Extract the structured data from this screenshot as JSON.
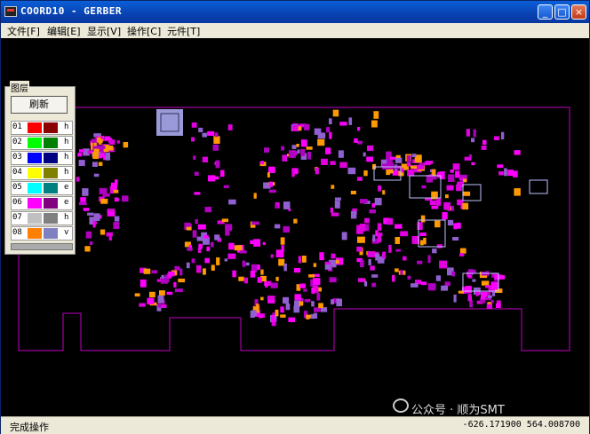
{
  "window": {
    "title": "COORD10 - GERBER",
    "controls": {
      "minimize": "_",
      "maximize": "□",
      "close": "×"
    }
  },
  "menu": [
    {
      "label": "文件[F]"
    },
    {
      "label": "编辑[E]"
    },
    {
      "label": "显示[V]"
    },
    {
      "label": "操作[C]"
    },
    {
      "label": "元件[T]"
    }
  ],
  "layer_panel": {
    "title": "图层",
    "refresh_label": "刷新",
    "layers": [
      {
        "num": "01",
        "color_a": "#ff0000",
        "color_b": "#8b0000",
        "flag": "h"
      },
      {
        "num": "02",
        "color_a": "#00ff00",
        "color_b": "#008000",
        "flag": "h"
      },
      {
        "num": "03",
        "color_a": "#0000ff",
        "color_b": "#000080",
        "flag": "h"
      },
      {
        "num": "04",
        "color_a": "#ffff00",
        "color_b": "#808000",
        "flag": "h"
      },
      {
        "num": "05",
        "color_a": "#00ffff",
        "color_b": "#008080",
        "flag": "e"
      },
      {
        "num": "06",
        "color_a": "#ff00ff",
        "color_b": "#800080",
        "flag": "e"
      },
      {
        "num": "07",
        "color_a": "#c0c0c0",
        "color_b": "#808080",
        "flag": "h"
      },
      {
        "num": "08",
        "color_a": "#ff8000",
        "color_b": "#8080c0",
        "flag": "v"
      }
    ]
  },
  "status": {
    "message": "完成操作",
    "coordinates": "-626.171900 564.008700"
  },
  "watermark": "公众号 · 顺为SMT",
  "colors": {
    "board_outline": "#c000c0",
    "pads": "#e000e0",
    "labels": "#ff9900",
    "background": "#000000"
  }
}
